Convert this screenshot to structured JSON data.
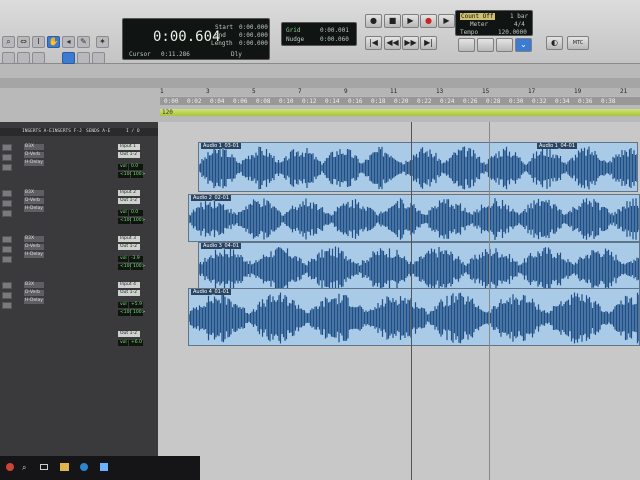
{
  "counter": {
    "main": "0:00.604",
    "start_label": "Start",
    "end_label": "End",
    "length_label": "Length",
    "start": "0:00.000",
    "end": "0:00.000",
    "length": "0:00.000",
    "cursor_label": "Cursor",
    "cursor": "0:11.286",
    "dly": "Dly"
  },
  "grid": {
    "grid_label": "Grid",
    "grid_value": "0:00.001",
    "nudge_label": "Nudge",
    "nudge_value": "0:00.060"
  },
  "count": {
    "count_off": "Count Off",
    "bars": "1 bar",
    "meter_label": "Meter",
    "meter": "4/4",
    "tempo_label": "Tempo",
    "tempo": "120.0000"
  },
  "mtc": "MTC",
  "ruler": {
    "bars": [
      "1",
      "3",
      "5",
      "7",
      "9",
      "11",
      "13",
      "15",
      "17",
      "19",
      "21"
    ],
    "min_secs": [
      "0:00",
      "0:02",
      "0:04",
      "0:06",
      "0:08",
      "0:10",
      "0:12",
      "0:14",
      "0:16",
      "0:18",
      "0:20",
      "0:22",
      "0:24",
      "0:26",
      "0:28",
      "0:30",
      "0:32",
      "0:34",
      "0:36",
      "0:38"
    ],
    "tempo_marker": "120"
  },
  "mixer_headers": {
    "inserts_ae": "INSERTS A-E",
    "inserts_fj": "INSERTS F-J",
    "sends_ae": "SENDS A-E",
    "io": "I / O"
  },
  "tracks": [
    {
      "ins1": "B3X",
      "ins2": "D-Verb",
      "ins3": "H-Delay",
      "input": "Input 1",
      "output": "Out 1-2",
      "vol": "vol",
      "vol_val": "0.0",
      "pan": "<100",
      "pan2": "100>"
    },
    {
      "ins1": "B3X",
      "ins2": "D-Verb",
      "ins3": "H-Delay",
      "input": "Input 2",
      "output": "Out 1-2",
      "vol": "vol",
      "vol_val": "0.0",
      "pan": "<100",
      "pan2": "100>"
    },
    {
      "ins1": "B3X",
      "ins2": "D-Verb",
      "ins3": "H-Delay",
      "input": "Input 3",
      "output": "Out 1-2",
      "vol": "vol",
      "vol_val": "-3.9",
      "pan": "<100",
      "pan2": "100>"
    },
    {
      "ins1": "B3X",
      "ins2": "D-Verb",
      "ins3": "H-Delay",
      "input": "Input 4",
      "output": "Out 1-2",
      "vol": "vol",
      "vol_val": "+5.9",
      "pan": "<100",
      "pan2": "100>"
    }
  ],
  "master": {
    "output": "Out 1-2",
    "vol": "vol",
    "vol_val": "+6.0"
  },
  "clips": [
    {
      "name": "Audio 1_03-01",
      "name2": "Audio 1_04-01"
    },
    {
      "name": "Audio 2_02-01"
    },
    {
      "name": "Audio 3_04-01"
    },
    {
      "name": "Audio 4_01-01"
    }
  ]
}
